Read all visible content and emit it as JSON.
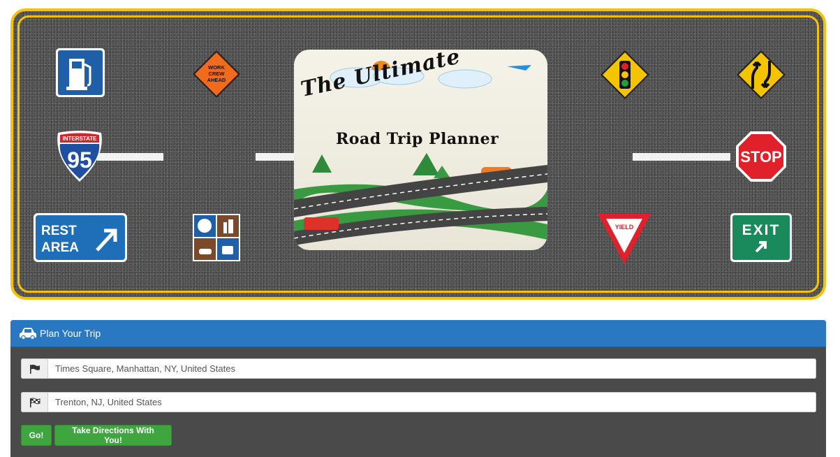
{
  "banner": {
    "logo": {
      "title_line1": "The Ultimate",
      "title_line2": "Road Trip Planner"
    },
    "signs": {
      "work_zone": [
        "WORK",
        "CREW",
        "AHEAD"
      ],
      "interstate_header": "INTERSTATE",
      "interstate_number": "95",
      "stop": "STOP",
      "rest_area": [
        "REST",
        "AREA"
      ],
      "yield": "YIELD",
      "exit": "EXIT"
    }
  },
  "panel": {
    "heading": "Plan Your Trip",
    "origin_value": "Times Square, Manhattan, NY, United States",
    "destination_value": "Trenton, NJ, United States",
    "go_button": "Go!",
    "take_directions_button": "Take Directions With You!"
  },
  "colors": {
    "accent_blue": "#2a78c1",
    "button_green": "#3fa63f",
    "panel_bg": "#4a4a4a",
    "road_border": "#f4c20d"
  },
  "icons": [
    "gas-station-icon",
    "work-crew-sign",
    "traffic-light-sign",
    "divided-highway-sign",
    "interstate-shield",
    "stop-sign",
    "rest-area-sign",
    "food-services-sign",
    "yield-sign",
    "exit-sign",
    "car-icon",
    "flag-icon",
    "checkered-flag-icon"
  ]
}
